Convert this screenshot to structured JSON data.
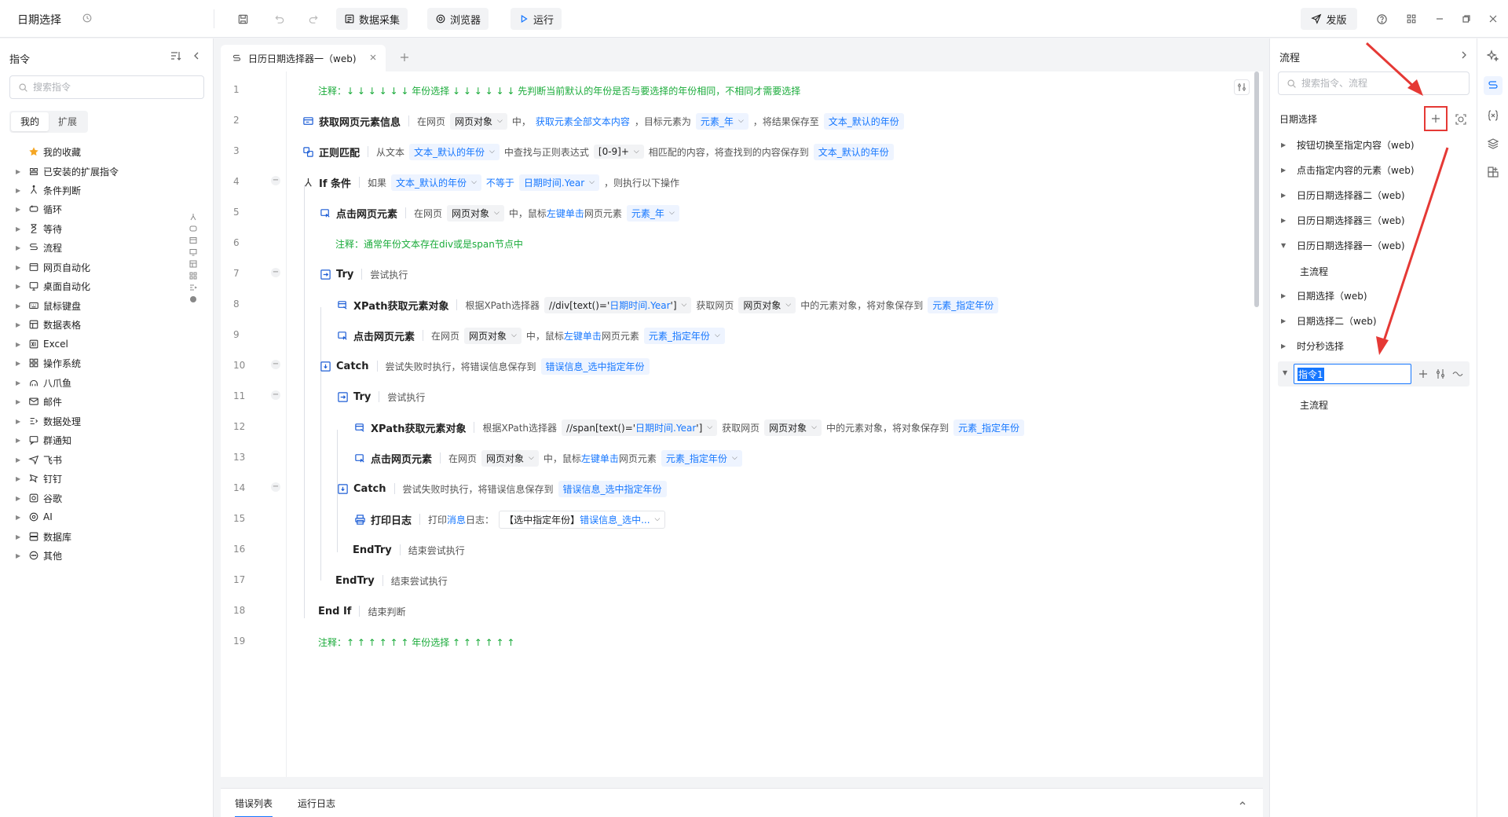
{
  "app": {
    "title": "日期选择",
    "toolbar": {
      "data_collect": "数据采集",
      "browser": "浏览器",
      "run": "运行",
      "publish": "发版"
    }
  },
  "commands_panel": {
    "title": "指令",
    "search_placeholder": "搜索指令",
    "tabs": [
      "我的",
      "扩展"
    ],
    "categories": [
      {
        "icon": "star-icon",
        "label": "我的收藏",
        "expandable": false
      },
      {
        "icon": "extension-icon",
        "label": "已安装的扩展指令",
        "expandable": true
      },
      {
        "icon": "branch-icon",
        "label": "条件判断",
        "expandable": true
      },
      {
        "icon": "loop-icon",
        "label": "循环",
        "expandable": true
      },
      {
        "icon": "hourglass-icon",
        "label": "等待",
        "expandable": true
      },
      {
        "icon": "flow-icon",
        "label": "流程",
        "expandable": true
      },
      {
        "icon": "web-automation-icon",
        "label": "网页自动化",
        "expandable": true
      },
      {
        "icon": "desktop-icon",
        "label": "桌面自动化",
        "expandable": true
      },
      {
        "icon": "keyboard-icon",
        "label": "鼠标键盘",
        "expandable": true
      },
      {
        "icon": "table-icon",
        "label": "数据表格",
        "expandable": true
      },
      {
        "icon": "excel-icon",
        "label": "Excel",
        "expandable": true
      },
      {
        "icon": "os-icon",
        "label": "操作系统",
        "expandable": true
      },
      {
        "icon": "octopus-icon",
        "label": "八爪鱼",
        "expandable": true
      },
      {
        "icon": "mail-icon",
        "label": "邮件",
        "expandable": true
      },
      {
        "icon": "data-process-icon",
        "label": "数据处理",
        "expandable": true
      },
      {
        "icon": "notify-icon",
        "label": "群通知",
        "expandable": true
      },
      {
        "icon": "feishu-icon",
        "label": "飞书",
        "expandable": true
      },
      {
        "icon": "dingtalk-icon",
        "label": "钉钉",
        "expandable": true
      },
      {
        "icon": "google-icon",
        "label": "谷歌",
        "expandable": true
      },
      {
        "icon": "ai-icon",
        "label": "AI",
        "expandable": true
      },
      {
        "icon": "database-icon",
        "label": "数据库",
        "expandable": true
      },
      {
        "icon": "more-icon",
        "label": "其他",
        "expandable": true
      }
    ]
  },
  "editor": {
    "tab_title": "日历日期选择器一（web)",
    "lines": [
      {
        "n": "1",
        "comment": "注释：↓ ↓ ↓ ↓ ↓ ↓   年份选择  ↓ ↓ ↓ ↓ ↓ ↓  先判断当前默认的年份是否与要选择的年份相同，不相同才需要选择"
      },
      {
        "n": "2",
        "kw": "获取网页元素信息",
        "t1": "在网页",
        "c1": "网页对象",
        "t2": "中，",
        "b1": "获取元素全部文本内容",
        "t3": "，目标元素为",
        "c2": "元素_年",
        "t4": "，将结果保存至",
        "c3": "文本_默认的年份"
      },
      {
        "n": "3",
        "kw": "正则匹配",
        "t1": "从文本",
        "c1": "文本_默认的年份",
        "t2": "中查找与正则表达式",
        "c2": "[0-9]+",
        "t3": "相匹配的内容，将查找到的内容保存到",
        "c3": "文本_默认的年份"
      },
      {
        "n": "4",
        "kw": "If 条件",
        "t1": "如果",
        "c1": "文本_默认的年份",
        "b1": "不等于",
        "c2": "日期时间.Year",
        "t2": "，则执行以下操作"
      },
      {
        "n": "5",
        "kw": "点击网页元素",
        "t1": "在网页",
        "c1": "网页对象",
        "t2": "中，鼠标",
        "b1": "左键单击",
        "t3": "网页元素",
        "c2": "元素_年"
      },
      {
        "n": "6",
        "comment": "注释：通常年份文本存在div或是span节点中"
      },
      {
        "n": "7",
        "kw": "Try",
        "t1": "尝试执行"
      },
      {
        "n": "8",
        "kw": "XPath获取元素对象",
        "t1": "根据XPath选择器",
        "c1a": "//div[text()='",
        "c1b": "日期时间.Year",
        "c1c": "']",
        "t2": "获取网页",
        "c2": "网页对象",
        "t3": "中的元素对象，将对象保存到",
        "c3": "元素_指定年份"
      },
      {
        "n": "9",
        "kw": "点击网页元素",
        "t1": "在网页",
        "c1": "网页对象",
        "t2": "中，鼠标",
        "b1": "左键单击",
        "t3": "网页元素",
        "c2": "元素_指定年份"
      },
      {
        "n": "10",
        "kw": "Catch",
        "t1": "尝试失败时执行，将错误信息保存到",
        "c1": "错误信息_选中指定年份"
      },
      {
        "n": "11",
        "kw": "Try",
        "t1": "尝试执行"
      },
      {
        "n": "12",
        "kw": "XPath获取元素对象",
        "t1": "根据XPath选择器",
        "c1a": "//span[text()='",
        "c1b": "日期时间.Year",
        "c1c": "']",
        "t2": "获取网页",
        "c2": "网页对象",
        "t3": "中的元素对象，将对象保存到",
        "c3": "元素_指定年份"
      },
      {
        "n": "13",
        "kw": "点击网页元素",
        "t1": "在网页",
        "c1": "网页对象",
        "t2": "中，鼠标",
        "b1": "左键单击",
        "t3": "网页元素",
        "c2": "元素_指定年份"
      },
      {
        "n": "14",
        "kw": "Catch",
        "t1": "尝试失败时执行，将错误信息保存到",
        "c1": "错误信息_选中指定年份"
      },
      {
        "n": "15",
        "kw": "打印日志",
        "t1": "打印",
        "b1": "消息",
        "t2": "日志：",
        "c1a": "【选中指定年份】",
        "c1b": "错误信息_选中..."
      },
      {
        "n": "16",
        "kw": "EndTry",
        "t1": "结束尝试执行"
      },
      {
        "n": "17",
        "kw": "EndTry",
        "t1": "结束尝试执行"
      },
      {
        "n": "18",
        "kw": "End If",
        "t1": "结束判断"
      },
      {
        "n": "19",
        "comment": "注释：↑ ↑ ↑ ↑ ↑ ↑   年份选择  ↑ ↑ ↑ ↑ ↑ ↑"
      }
    ]
  },
  "bottom_tabs": [
    "错误列表",
    "运行日志"
  ],
  "flow_panel": {
    "title": "流程",
    "search_placeholder": "搜索指令、流程",
    "project": "日期选择",
    "items": [
      {
        "label": "按钮切换至指定内容（web)",
        "expanded": false
      },
      {
        "label": "点击指定内容的元素（web)",
        "expanded": false
      },
      {
        "label": "日历日期选择器二（web)",
        "expanded": false
      },
      {
        "label": "日历日期选择器三（web)",
        "expanded": false
      },
      {
        "label": "日历日期选择器一（web)",
        "expanded": true
      },
      {
        "label": "主流程",
        "child": true
      },
      {
        "label": "日期选择（web)",
        "expanded": false
      },
      {
        "label": "日期选择二（web)",
        "expanded": false
      },
      {
        "label": "时分秒选择",
        "expanded": false
      }
    ],
    "editing_value": "指令1",
    "editing_child": "主流程"
  },
  "colors": {
    "accent": "#1677ff",
    "comment_green": "#1aab3a",
    "annotation_red": "#e53935"
  }
}
